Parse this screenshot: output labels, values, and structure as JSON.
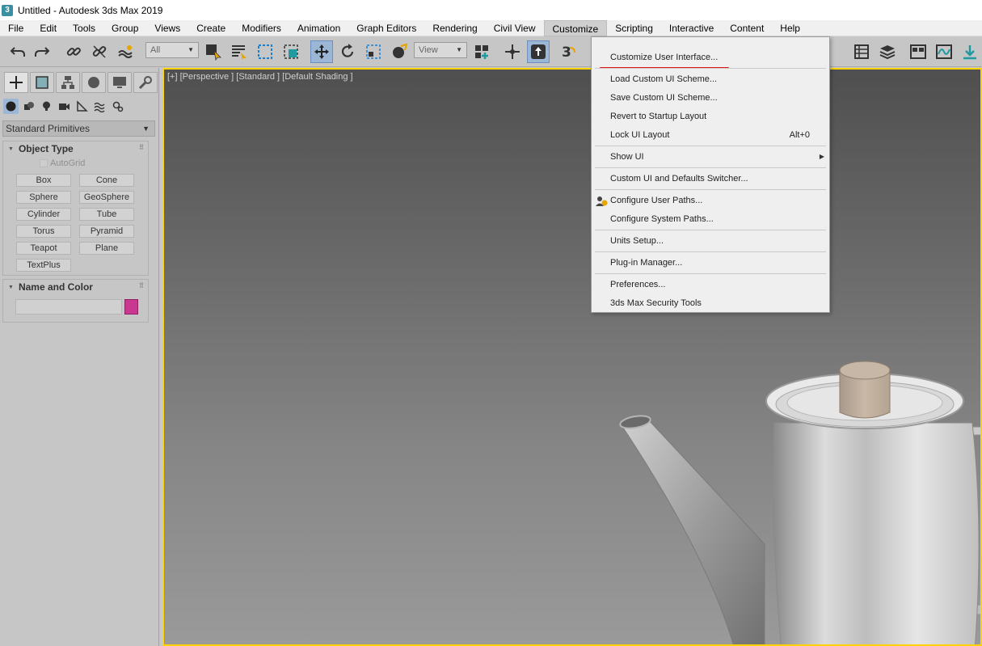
{
  "window": {
    "title": "Untitled - Autodesk 3ds Max 2019",
    "app_icon": "3"
  },
  "menubar": {
    "items": [
      "File",
      "Edit",
      "Tools",
      "Group",
      "Views",
      "Create",
      "Modifiers",
      "Animation",
      "Graph Editors",
      "Rendering",
      "Civil View",
      "Customize",
      "Scripting",
      "Interactive",
      "Content",
      "Help"
    ],
    "active": "Customize"
  },
  "toolbar": {
    "selection_filter": "All",
    "reference_coord": "View",
    "snap_label": "3"
  },
  "command_panel": {
    "category_dropdown": "Standard Primitives",
    "object_type": {
      "title": "Object Type",
      "autogrid_label": "AutoGrid",
      "buttons": [
        "Box",
        "Cone",
        "Sphere",
        "GeoSphere",
        "Cylinder",
        "Tube",
        "Torus",
        "Pyramid",
        "Teapot",
        "Plane",
        "TextPlus"
      ]
    },
    "name_and_color": {
      "title": "Name and Color",
      "color": "#c83790"
    }
  },
  "viewport": {
    "label": "[+] [Perspective ] [Standard ] [Default Shading ]",
    "border_color": "#ffd400"
  },
  "customize_menu": {
    "items": [
      {
        "label": "Customize User Interface...",
        "underline_red": true
      },
      {
        "label": "Load Custom UI Scheme..."
      },
      {
        "label": "Save Custom UI Scheme..."
      },
      {
        "label": "Revert to Startup Layout"
      },
      {
        "label": "Lock UI Layout",
        "shortcut": "Alt+0"
      },
      {
        "label": "Show UI",
        "submenu": true
      },
      {
        "label": "Custom UI and Defaults Switcher..."
      },
      {
        "label": "Configure User Paths...",
        "icon": "configure-paths-icon"
      },
      {
        "label": "Configure System Paths..."
      },
      {
        "label": "Units Setup..."
      },
      {
        "label": "Plug-in Manager..."
      },
      {
        "label": "Preferences..."
      },
      {
        "label": "3ds Max Security Tools"
      }
    ]
  }
}
